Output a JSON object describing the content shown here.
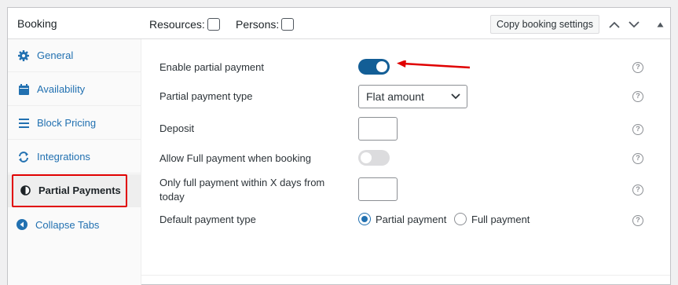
{
  "header": {
    "title": "Booking",
    "resources_label": "Resources:",
    "persons_label": "Persons:",
    "copy_button": "Copy booking settings",
    "icons": [
      "chevron-up-icon",
      "chevron-down-icon",
      "collapse-triangle-icon"
    ]
  },
  "sidebar": {
    "items": [
      {
        "label": "General",
        "icon": "gear-icon"
      },
      {
        "label": "Availability",
        "icon": "calendar-icon"
      },
      {
        "label": "Block Pricing",
        "icon": "list-icon"
      },
      {
        "label": "Integrations",
        "icon": "sync-icon"
      },
      {
        "label": "Partial Payments",
        "icon": "half-circle-icon",
        "active": true
      },
      {
        "label": "Collapse Tabs",
        "icon": "arrow-left-circle-icon"
      }
    ]
  },
  "form": {
    "enable_partial_label": "Enable partial payment",
    "enable_partial_on": true,
    "partial_type_label": "Partial payment type",
    "partial_type_value": "Flat amount",
    "deposit_label": "Deposit",
    "deposit_value": "",
    "allow_full_label": "Allow Full payment when booking",
    "allow_full_on": false,
    "only_full_label": "Only full payment within X days from today",
    "only_full_value": "",
    "default_type_label": "Default payment type",
    "radio_partial": "Partial payment",
    "radio_full": "Full payment",
    "default_type_selected": "Partial payment"
  },
  "colors": {
    "accent": "#2271b1",
    "toggle_on": "#135e96",
    "highlight": "#e00000"
  }
}
